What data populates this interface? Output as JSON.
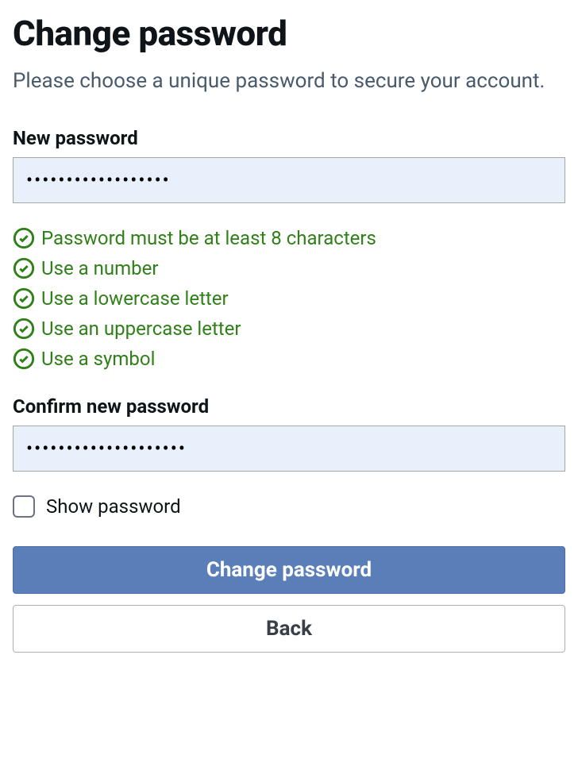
{
  "header": {
    "title": "Change password",
    "subtitle": "Please choose a unique password to secure your account."
  },
  "new_password": {
    "label": "New password",
    "value": "••••••••••••••••••"
  },
  "requirements": [
    {
      "text": "Password must be at least 8 characters",
      "met": true
    },
    {
      "text": "Use a number",
      "met": true
    },
    {
      "text": "Use a lowercase letter",
      "met": true
    },
    {
      "text": "Use an uppercase letter",
      "met": true
    },
    {
      "text": "Use a symbol",
      "met": true
    }
  ],
  "confirm_password": {
    "label": "Confirm new password",
    "value": "••••••••••••••••••••"
  },
  "show_password": {
    "label": "Show password",
    "checked": false
  },
  "buttons": {
    "submit": "Change password",
    "back": "Back"
  },
  "colors": {
    "success": "#2f8018",
    "primary_button": "#5a7fb8",
    "input_bg": "#e7f0fb"
  }
}
